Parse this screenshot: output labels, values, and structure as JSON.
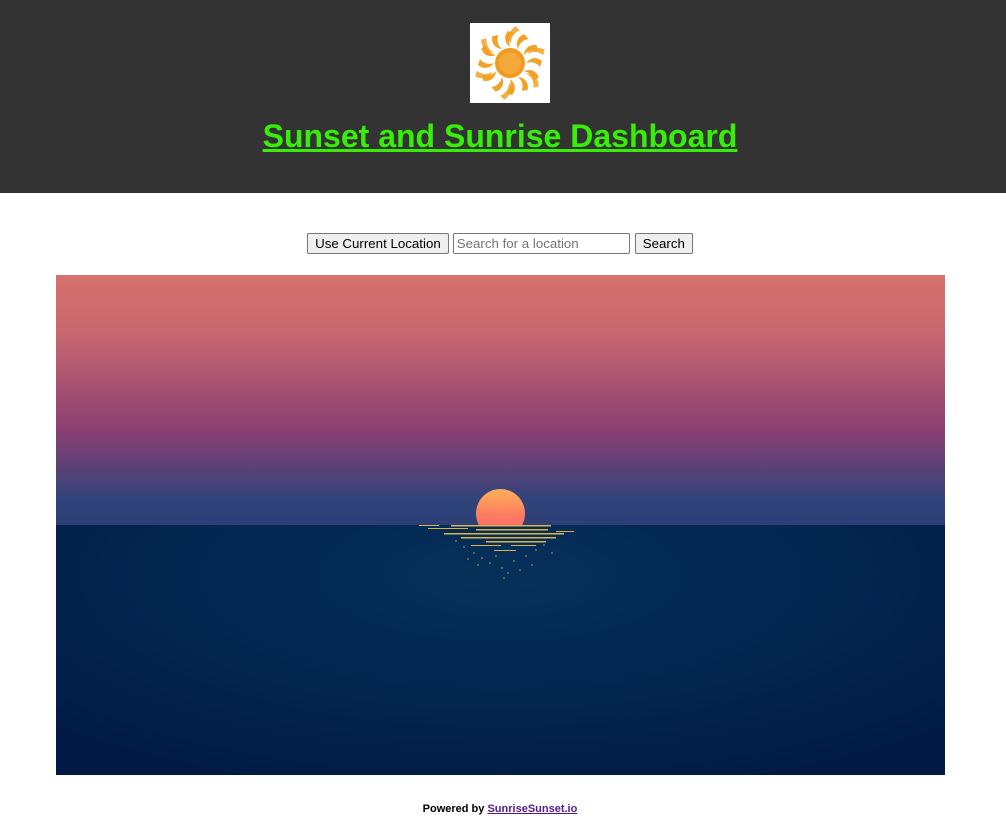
{
  "header": {
    "title": "Sunset and Sunrise Dashboard",
    "logo_icon": "sun-logo-icon",
    "background_color": "#333333",
    "title_color": "#37ee0b"
  },
  "controls": {
    "current_location_label": "Use Current Location",
    "search_placeholder": "Search for a location",
    "search_value": "",
    "search_button_label": "Search"
  },
  "footer": {
    "powered_by_text": "Powered by",
    "link_text": "SunriseSunset.io"
  }
}
